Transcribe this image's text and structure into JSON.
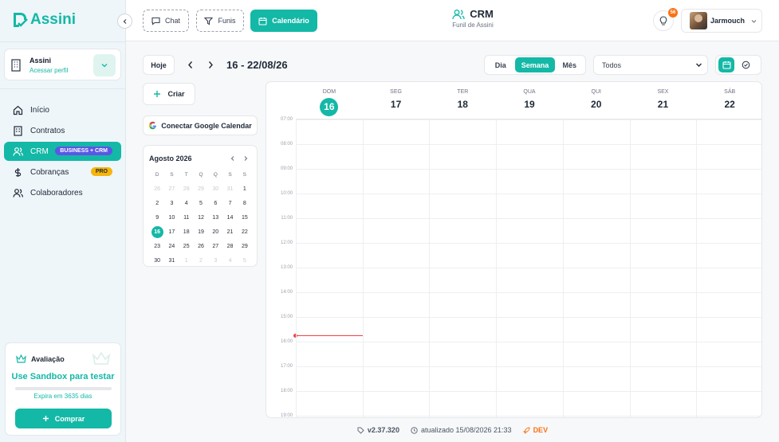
{
  "app": {
    "logo_text": "Assini"
  },
  "account": {
    "name": "Assini",
    "link": "Acessar perfil"
  },
  "nav": {
    "items": [
      {
        "label": "Início",
        "icon": "home-icon"
      },
      {
        "label": "Contratos",
        "icon": "building-icon"
      },
      {
        "label": "CRM",
        "icon": "users-icon",
        "badge": "BUSINESS + CRM"
      },
      {
        "label": "Cobranças",
        "icon": "dollar-icon",
        "badge": "PRO"
      },
      {
        "label": "Colaboradores",
        "icon": "users-icon"
      }
    ]
  },
  "evaluation": {
    "title": "Avaliação",
    "sandbox": "Use Sandbox para testar",
    "expires": "Expira em 3635 dias",
    "buy": "Comprar",
    "progress": 0.0
  },
  "topbar": {
    "tabs": [
      "Chat",
      "Funis",
      "Calendário"
    ],
    "title": "CRM",
    "subtitle": "Funil de Assini",
    "notif_count": "56",
    "user_name": "Jarmouch"
  },
  "toolbar": {
    "today": "Hoje",
    "range": "16 - 22/08/26",
    "views": [
      "Dia",
      "Semana",
      "Mês"
    ],
    "active_view": "Semana",
    "filter": "Todos",
    "create": "Criar",
    "google": "Conectar Google Calendar"
  },
  "mini_calendar": {
    "month": "Agosto 2026",
    "weekdays": [
      "D",
      "S",
      "T",
      "Q",
      "Q",
      "S",
      "S"
    ],
    "weeks": [
      [
        "26",
        "27",
        "28",
        "29",
        "30",
        "31",
        "1"
      ],
      [
        "2",
        "3",
        "4",
        "5",
        "6",
        "7",
        "8"
      ],
      [
        "9",
        "10",
        "11",
        "12",
        "13",
        "14",
        "15"
      ],
      [
        "16",
        "17",
        "18",
        "19",
        "20",
        "21",
        "22"
      ],
      [
        "23",
        "24",
        "25",
        "26",
        "27",
        "28",
        "29"
      ],
      [
        "30",
        "31",
        "1",
        "2",
        "3",
        "4",
        "5"
      ]
    ],
    "selected": "16"
  },
  "week": {
    "days": [
      {
        "wd": "DOM",
        "num": "16",
        "today": true
      },
      {
        "wd": "SEG",
        "num": "17"
      },
      {
        "wd": "TER",
        "num": "18"
      },
      {
        "wd": "QUA",
        "num": "19"
      },
      {
        "wd": "QUI",
        "num": "20"
      },
      {
        "wd": "SEX",
        "num": "21"
      },
      {
        "wd": "SÁB",
        "num": "22"
      }
    ],
    "hours": [
      "07:00",
      "08:00",
      "09:00",
      "10:00",
      "11:00",
      "12:00",
      "13:00",
      "14:00",
      "15:00",
      "16:00",
      "17:00",
      "18:00",
      "19:00"
    ]
  },
  "footer": {
    "version": "v2.37.320",
    "updated": "atualizado 15/08/2026 21:33",
    "env": "DEV"
  }
}
